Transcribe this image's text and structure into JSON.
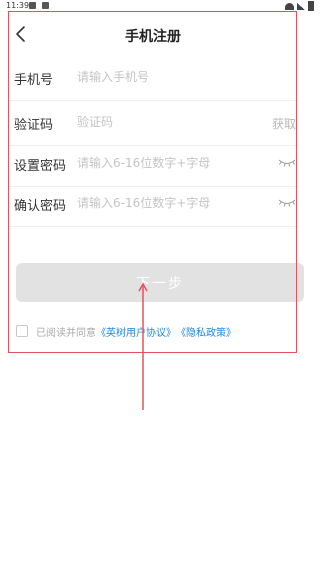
{
  "status_bar": {
    "time": "11:39"
  },
  "header": {
    "title": "手机注册"
  },
  "form": {
    "phone": {
      "label": "手机号",
      "placeholder": "请输入手机号"
    },
    "code": {
      "label": "验证码",
      "placeholder": "验证码",
      "action": "获取"
    },
    "password": {
      "label": "设置密码",
      "placeholder": "请输入6-16位数字+字母"
    },
    "confirm": {
      "label": "确认密码",
      "placeholder": "请输入6-16位数字+字母"
    }
  },
  "next_label": "下一步",
  "agreement": {
    "prefix": "已阅读并同意",
    "user_agreement": "《英树用户协议》",
    "privacy_policy": "《隐私政策》",
    "checked": false
  },
  "colors": {
    "annotation": "#e8505b",
    "link": "#1e88e5",
    "button_disabled": "#e2e2e2"
  }
}
